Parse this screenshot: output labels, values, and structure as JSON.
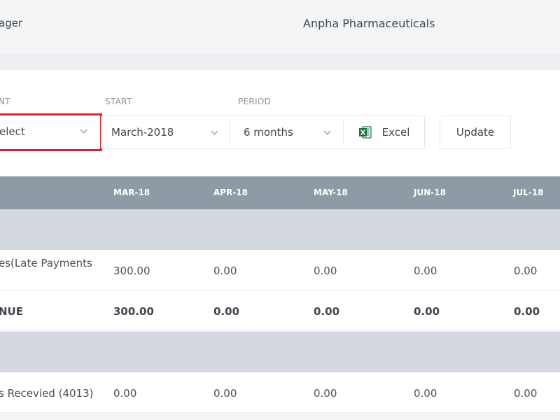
{
  "topbar": {
    "left_text": "ager",
    "company": "Anpha Pharmaceuticals"
  },
  "filters": {
    "account_label": "NT",
    "start_label": "START",
    "period_label": "PERIOD",
    "account_value": "elect",
    "start_value": "March-2018",
    "period_value": "6 months",
    "excel_label": "Excel",
    "update_label": "Update"
  },
  "table": {
    "columns": [
      "MAR-18",
      "APR-18",
      "MAY-18",
      "JUN-18",
      "JUL-18"
    ],
    "rows": [
      {
        "label": "es(Late Payments",
        "values": [
          "300.00",
          "0.00",
          "0.00",
          "0.00",
          "0.00"
        ]
      },
      {
        "label": "NUE",
        "values": [
          "300.00",
          "0.00",
          "0.00",
          "0.00",
          "0.00"
        ]
      },
      {
        "label": "s Recevied (4013)",
        "values": [
          "0.00",
          "0.00",
          "0.00",
          "0.00",
          "0.00"
        ]
      }
    ]
  },
  "colors": {
    "highlight_border": "#d9232e",
    "table_header_bg": "#8e9ba6",
    "section_row_bg": "#d3d9df",
    "excel_icon": "#1e7145"
  }
}
